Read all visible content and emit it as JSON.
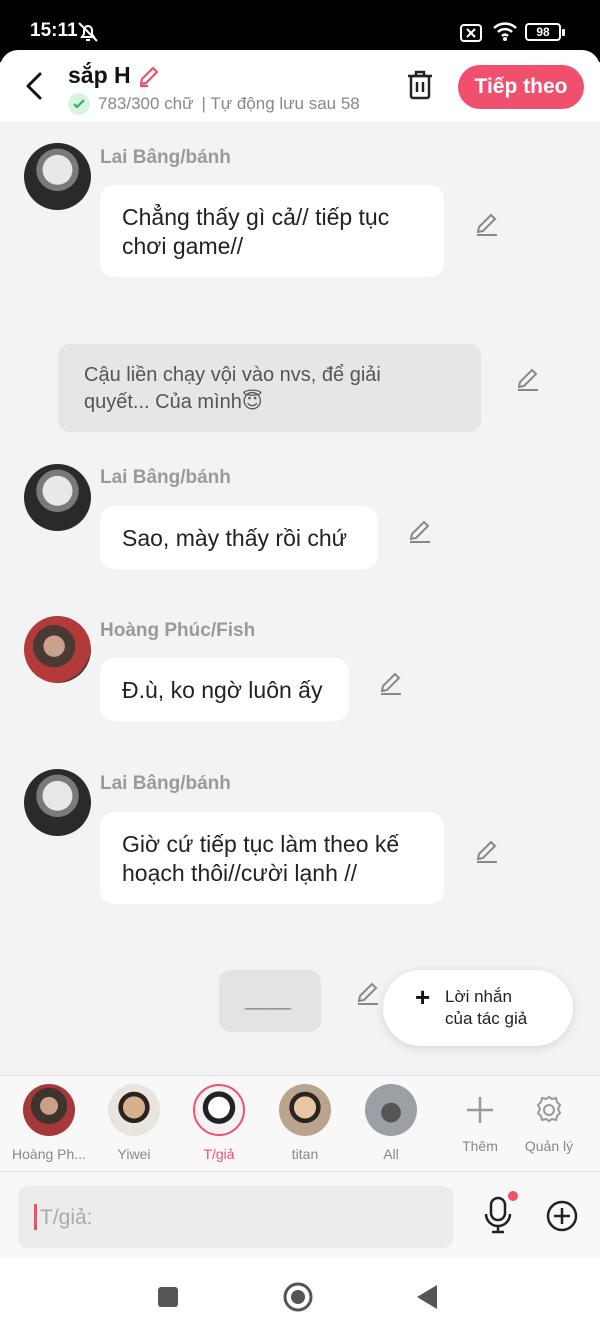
{
  "status": {
    "time": "15:11",
    "battery": "98"
  },
  "header": {
    "title": "sắp H",
    "word_count": "783/300 chữ",
    "autosave": "| Tự động lưu sau 58",
    "next_label": "Tiếp theo"
  },
  "messages": [
    {
      "sender": "Lai Bâng/bánh",
      "text_line1": "Chẳng thấy gì cả// tiếp tục",
      "text_line2": "chơi game//"
    },
    {
      "narration_line1": "Cậu liền chạy vội vào nvs, để giải",
      "narration_line2": "quyết... Của mình😇"
    },
    {
      "sender": "Lai Bâng/bánh",
      "text": "Sao, mày thấy rồi chứ"
    },
    {
      "sender": "Hoàng Phúc/Fish",
      "text": "Đ.ù, ko ngờ luôn ấy"
    },
    {
      "sender": "Lai Bâng/bánh",
      "text_line1": "Giờ cứ tiếp tục làm theo kế",
      "text_line2": "hoạch thôi//cười lạnh //"
    }
  ],
  "placeholder_bubble": "_____",
  "author_note": {
    "line1": "Lời nhắn",
    "line2": "của tác giả"
  },
  "characters": [
    {
      "name": "Hoàng Ph..."
    },
    {
      "name": "Yiwei"
    },
    {
      "name": "T/giả"
    },
    {
      "name": "titan"
    },
    {
      "name": "All"
    }
  ],
  "tools": {
    "add_label": "Thêm",
    "manage_label": "Quản lý"
  },
  "input": {
    "placeholder": "T/giả:"
  },
  "colors": {
    "accent": "#f0506e",
    "background": "#f3f3f3",
    "bubble": "#ffffff"
  }
}
